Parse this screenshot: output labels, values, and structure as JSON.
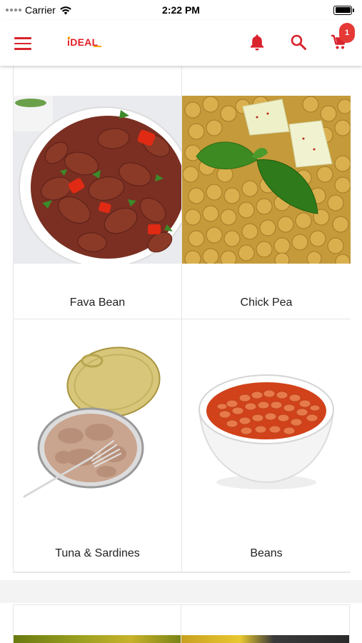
{
  "status_bar": {
    "carrier": "Carrier",
    "time": "2:22 PM",
    "battery_level": 1.0
  },
  "nav": {
    "logo_text": "IDEAL",
    "cart_count": "1",
    "icons": [
      "menu-icon",
      "bell-icon",
      "search-icon",
      "cart-icon"
    ],
    "accent_color": "#d9232d"
  },
  "categories": [
    {
      "name": "Fava Bean"
    },
    {
      "name": "Chick Pea"
    },
    {
      "name": "Tuna & Sardines"
    },
    {
      "name": "Beans"
    }
  ]
}
